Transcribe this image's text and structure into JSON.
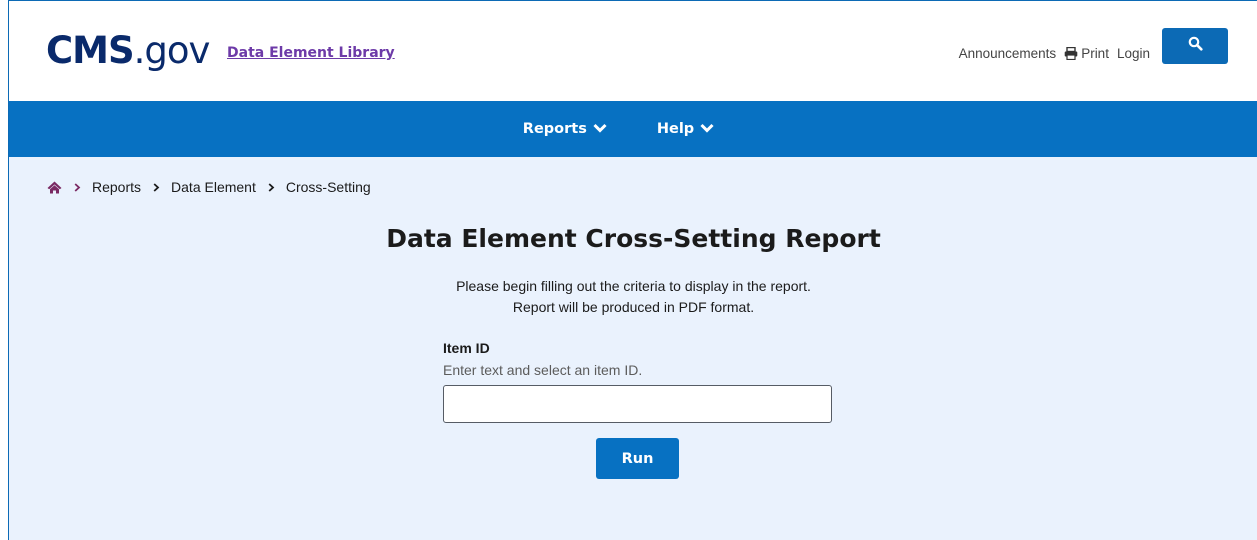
{
  "header": {
    "logo_main": "CMS",
    "logo_suffix": ".gov",
    "library_link": "Data Element Library",
    "announcements": "Announcements",
    "print": "Print",
    "login": "Login",
    "search_icon": "search-icon",
    "print_icon": "printer-icon"
  },
  "nav": {
    "items": [
      {
        "label": "Reports",
        "icon": "chevron-down-icon"
      },
      {
        "label": "Help",
        "icon": "chevron-down-icon"
      }
    ]
  },
  "breadcrumb": {
    "home_icon": "home-icon",
    "items": [
      "Reports",
      "Data Element",
      "Cross-Setting"
    ]
  },
  "main": {
    "title": "Data Element Cross-Setting Report",
    "description_line1": "Please begin filling out the criteria to display in the report.",
    "description_line2": "Report will be produced in PDF format.",
    "field_label": "Item ID",
    "field_hint": "Enter text and select an item ID.",
    "field_value": "",
    "run_label": "Run"
  },
  "colors": {
    "primary": "#0771c2",
    "page_bg": "#eaf2fd",
    "logo": "#0a2a6b",
    "link_purple": "#6d3aa8"
  }
}
